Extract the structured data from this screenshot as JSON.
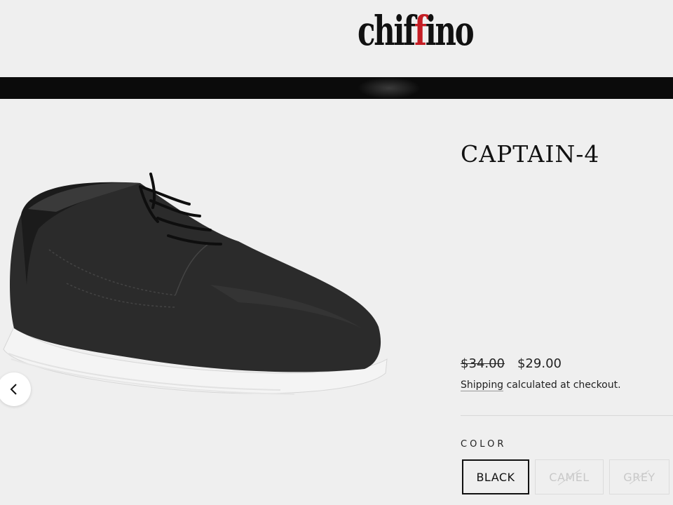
{
  "brand": {
    "logo_text_before": "chif",
    "logo_text_accent": "f",
    "logo_text_after": "ino",
    "accent_color": "#c41d24"
  },
  "gallery": {
    "prev_icon": "chevron-left-icon"
  },
  "product": {
    "title": "CAPTAIN-4",
    "compare_price": "$34.00",
    "price": "$29.00",
    "shipping_link": "Shipping",
    "shipping_rest": " calculated at checkout.",
    "color_label": "COLOR",
    "colors": [
      {
        "label": "BLACK",
        "available": true,
        "selected": true
      },
      {
        "label": "CAMEL",
        "available": false,
        "selected": false
      },
      {
        "label": "GREY",
        "available": false,
        "selected": false
      }
    ]
  }
}
